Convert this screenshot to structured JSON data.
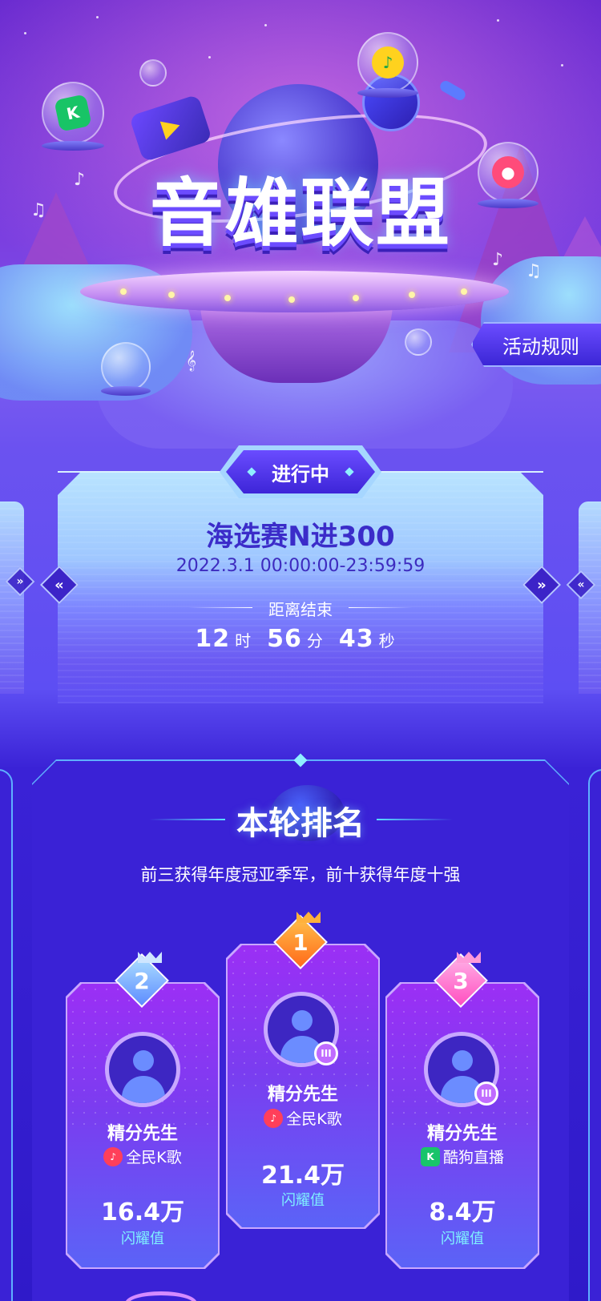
{
  "hero": {
    "logo_text": "音雄联盟",
    "rules_button": "活动规则"
  },
  "stage": {
    "status": "进行中",
    "title": "海选赛N进300",
    "date_range": "2022.3.1 00:00:00-23:59:59",
    "countdown_label": "距离结束",
    "countdown": {
      "hours": "12",
      "hours_unit": "时",
      "minutes": "56",
      "minutes_unit": "分",
      "seconds": "43",
      "seconds_unit": "秒"
    },
    "prev_arrow": "«",
    "next_arrow": "»"
  },
  "ranking": {
    "title": "本轮排名",
    "subtitle": "前三获得年度冠亚季军，前十获得年度十强",
    "podium": [
      {
        "rank": "1",
        "name": "精分先生",
        "platform": "全民K歌",
        "score": "21.4万",
        "score_label": "闪耀值",
        "color": "#ff8a2a"
      },
      {
        "rank": "2",
        "name": "精分先生",
        "platform": "全民K歌",
        "score": "16.4万",
        "score_label": "闪耀值",
        "color": "#7fb6ff"
      },
      {
        "rank": "3",
        "name": "精分先生",
        "platform": "酷狗直播",
        "score": "8.4万",
        "score_label": "闪耀值",
        "color": "#ff6fd0"
      }
    ]
  },
  "icons": {
    "kugou": "K",
    "karaoke": "♪",
    "live": "III"
  },
  "colors": {
    "accent": "#3b26d6",
    "cyan": "#7ff0ff",
    "rank1": "#ff8a2a",
    "rank2": "#7fb6ff",
    "rank3": "#ff6fd0"
  }
}
